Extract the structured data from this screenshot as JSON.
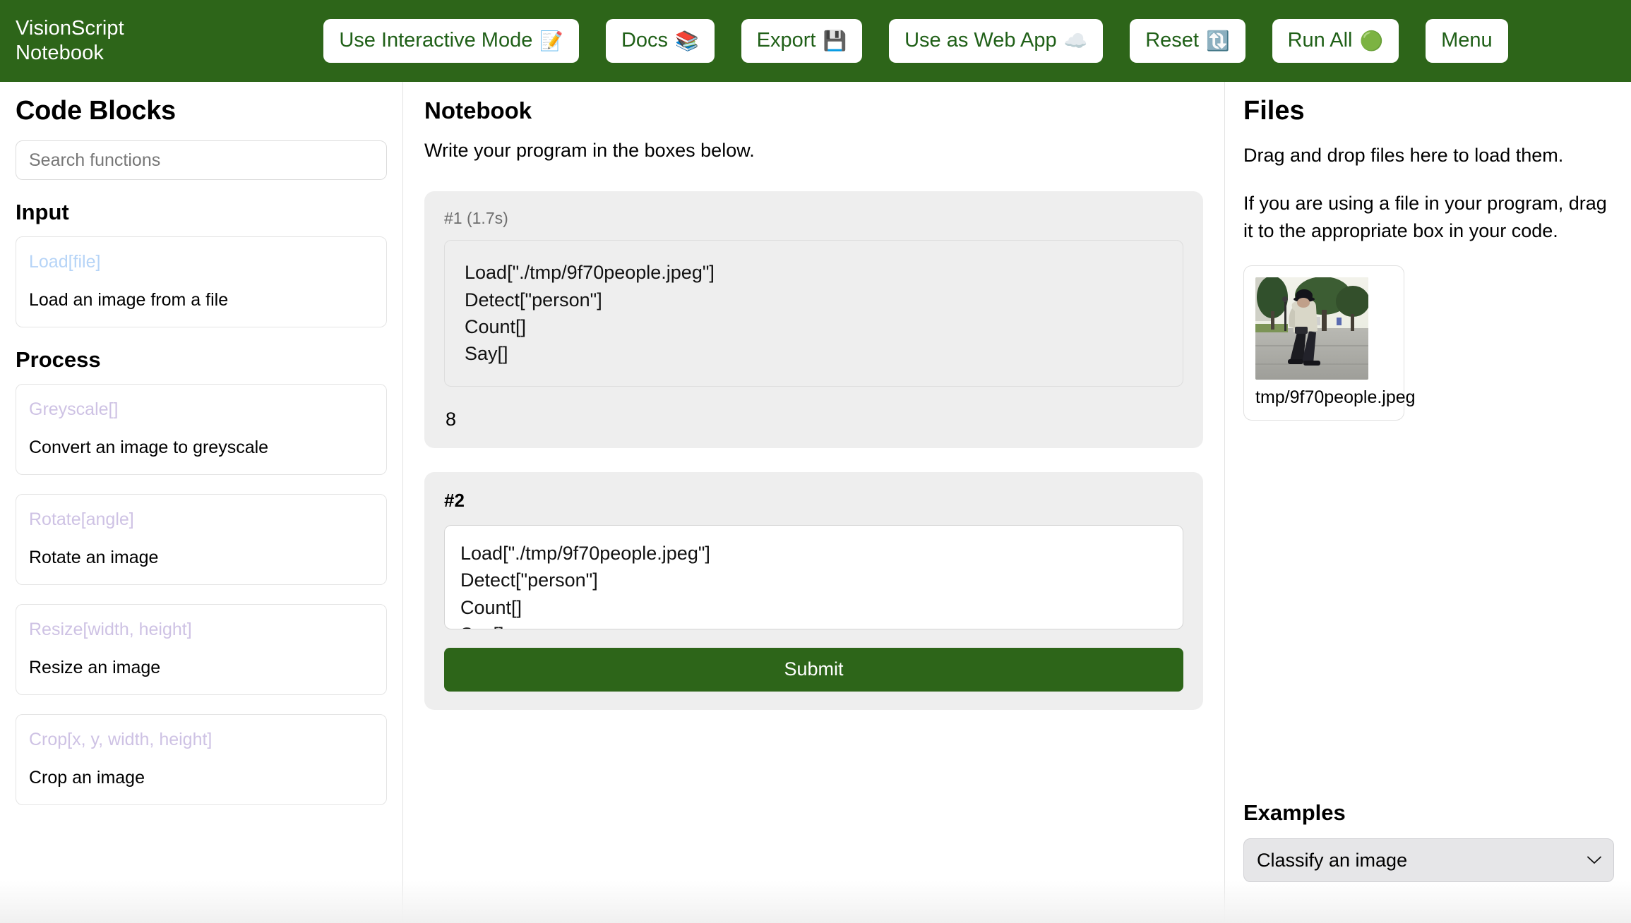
{
  "header": {
    "brand_line1": "VisionScript",
    "brand_line2": "Notebook",
    "buttons": [
      {
        "label": "Use Interactive Mode",
        "emoji": "📝",
        "icon": "memo-icon"
      },
      {
        "label": "Docs",
        "emoji": "📚",
        "icon": "books-icon"
      },
      {
        "label": "Export",
        "emoji": "💾",
        "icon": "floppy-disk-icon"
      },
      {
        "label": "Use as Web App",
        "emoji": "☁️",
        "icon": "cloud-icon"
      },
      {
        "label": "Reset",
        "emoji": "🔃",
        "icon": "refresh-icon"
      },
      {
        "label": "Run All",
        "emoji": "🟢",
        "icon": "green-circle-icon"
      },
      {
        "label": "Menu",
        "emoji": "",
        "icon": "menu-icon"
      }
    ],
    "bg_color": "#2d6519",
    "button_text_color": "#206018"
  },
  "sidebar": {
    "title": "Code Blocks",
    "search_placeholder": "Search functions",
    "search_value": "",
    "groups": [
      {
        "name": "Input",
        "color": "#b6d4f7",
        "items": [
          {
            "signature": "Load[file]",
            "description": "Load an image from a file"
          }
        ]
      },
      {
        "name": "Process",
        "color": "#cec2e4",
        "items": [
          {
            "signature": "Greyscale[]",
            "description": "Convert an image to greyscale"
          },
          {
            "signature": "Rotate[angle]",
            "description": "Rotate an image"
          },
          {
            "signature": "Resize[width, height]",
            "description": "Resize an image"
          },
          {
            "signature": "Crop[x, y, width, height]",
            "description": "Crop an image"
          }
        ]
      }
    ]
  },
  "notebook": {
    "title": "Notebook",
    "subtitle": "Write your program in the boxes below.",
    "cells": [
      {
        "label": "#1 (1.7s)",
        "code": "Load[\"./tmp/9f70people.jpeg\"]\nDetect[\"person\"]\nCount[]\nSay[]",
        "output": "8",
        "editable": false
      },
      {
        "label": "#2",
        "code": "Load[\"./tmp/9f70people.jpeg\"]\nDetect[\"person\"]\nCount[]\nSay[]",
        "output": "",
        "editable": true,
        "submit_label": "Submit"
      }
    ]
  },
  "files": {
    "title": "Files",
    "paragraph1": "Drag and drop files here to load them.",
    "paragraph2": "If you are using a file in your program, drag it to the appropriate box in your code.",
    "items": [
      {
        "name": "tmp/9f70people.jpeg",
        "alt": "street scene with a person walking"
      }
    ]
  },
  "examples": {
    "title": "Examples",
    "selected": "Classify an image",
    "options": [
      "Classify an image"
    ]
  }
}
